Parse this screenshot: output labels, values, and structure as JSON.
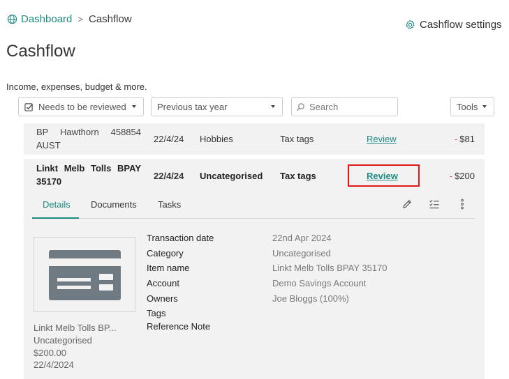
{
  "breadcrumb": {
    "link": "Dashboard",
    "separator": ">",
    "current": "Cashflow"
  },
  "settings_link": "Cashflow settings",
  "page_title": "Cashflow",
  "subtitle": "Income, expenses, budget & more.",
  "filters": {
    "review_status": "Needs to be reviewed",
    "period": "Previous tax year",
    "search_placeholder": "Search",
    "tools": "Tools"
  },
  "transactions": [
    {
      "description": "BP Hawthorn 458854 AUST",
      "date": "22/4/24",
      "category": "Hobbies",
      "tags_label": "Tax tags",
      "action": "Review",
      "sign": "-",
      "amount": "$81"
    },
    {
      "description": "Linkt Melb Tolls BPAY 35170",
      "date": "22/4/24",
      "category": "Uncategorised",
      "tags_label": "Tax tags",
      "action": "Review",
      "sign": "-",
      "amount": "$200"
    }
  ],
  "detail": {
    "tabs": [
      "Details",
      "Documents",
      "Tasks"
    ],
    "active_tab": "Details",
    "card": {
      "name": "Linkt Melb Tolls BP...",
      "category": "Uncategorised",
      "amount": "$200.00",
      "date": "22/4/2024"
    },
    "fields": [
      {
        "label": "Transaction date",
        "value": "22nd Apr 2024"
      },
      {
        "label": "Category",
        "value": "Uncategorised"
      },
      {
        "label": "Item name",
        "value": "Linkt Melb Tolls BPAY 35170"
      },
      {
        "label": "Account",
        "value": "Demo Savings Account"
      },
      {
        "label": "Owners",
        "value": "Joe Bloggs (100%)"
      },
      {
        "label": "Tags",
        "value": ""
      },
      {
        "label": "Reference Note",
        "value": ""
      }
    ]
  },
  "colors": {
    "accent": "#1e8a80",
    "negative": "#e0533c",
    "highlight": "#e01818",
    "row_bg": "#f2f2f2"
  },
  "icons": [
    "globe-icon",
    "gear-icon",
    "checkbox-icon",
    "search-icon",
    "pencil-icon",
    "checklist-icon",
    "more-vertical-icon",
    "card-icon"
  ]
}
